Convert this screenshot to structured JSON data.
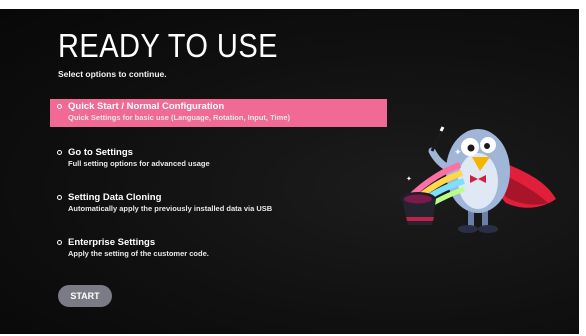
{
  "header": {
    "title": "READY TO USE",
    "subtitle": "Select options to continue."
  },
  "options": [
    {
      "title": "Quick Start / Normal Configuration",
      "description": "Quick Settings for basic use (Language, Rotation, Input, Time)",
      "selected": true
    },
    {
      "title": "Go to Settings",
      "description": "Full setting options for advanced usage",
      "selected": false
    },
    {
      "title": "Setting Data Cloning",
      "description": "Automatically apply the previously installed data via USB",
      "selected": false
    },
    {
      "title": "Enterprise Settings",
      "description": "Apply the setting of the customer code.",
      "selected": false
    }
  ],
  "start_button": {
    "label": "START"
  },
  "colors": {
    "background": "#101010",
    "highlight": "#f06a95",
    "button": "#7b7b86",
    "text": "#ffffff"
  },
  "icons": {
    "mascot": "magician-bird-mascot-icon",
    "bullet": "ring-bullet-icon"
  }
}
